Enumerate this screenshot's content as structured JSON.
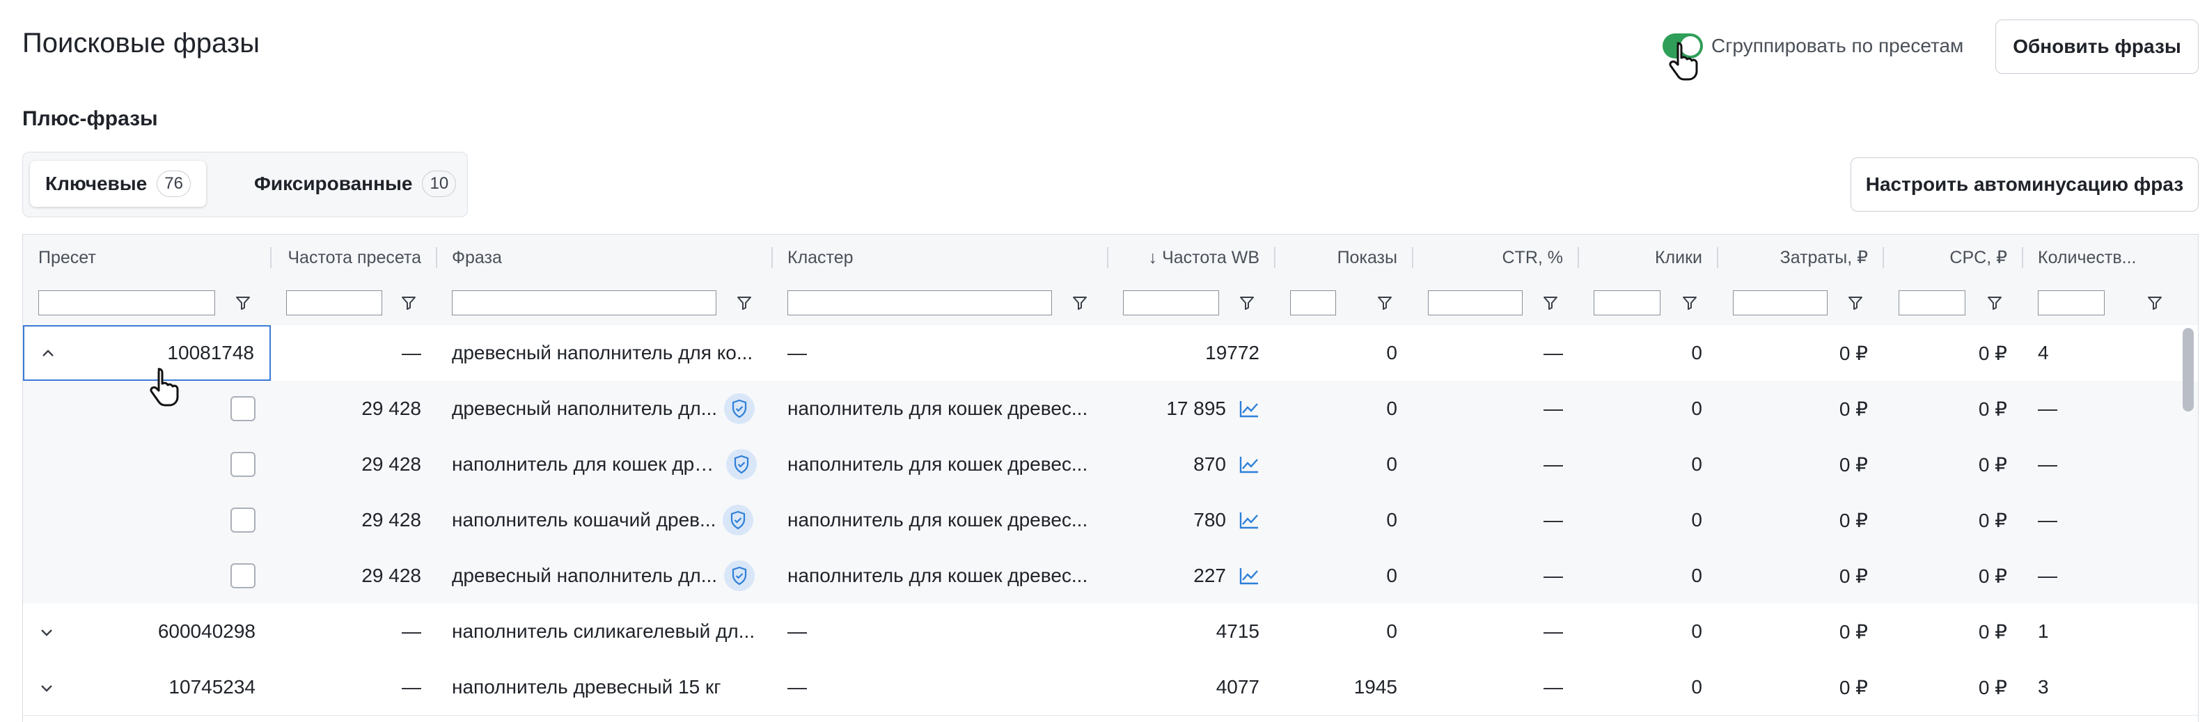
{
  "page": {
    "title": "Поисковые фразы",
    "group_toggle": {
      "label": "Сгруппировать по пресетам",
      "on": true
    },
    "refresh_button": "Обновить фразы",
    "section_title": "Плюс-фразы",
    "tabs": [
      {
        "label": "Ключевые",
        "count": "76",
        "active": true
      },
      {
        "label": "Фиксированные",
        "count": "10",
        "active": false
      }
    ],
    "autominus_button": "Настроить автоминусацию фраз"
  },
  "table": {
    "columns": [
      {
        "key": "preset",
        "label": "Пресет"
      },
      {
        "key": "preset_freq",
        "label": "Частота пресета"
      },
      {
        "key": "phrase",
        "label": "Фраза"
      },
      {
        "key": "cluster",
        "label": "Кластер"
      },
      {
        "key": "wb_freq",
        "label": "↓ Частота WB"
      },
      {
        "key": "views",
        "label": "Показы"
      },
      {
        "key": "ctr",
        "label": "CTR, %"
      },
      {
        "key": "clicks",
        "label": "Клики"
      },
      {
        "key": "cost",
        "label": "Затраты, ₽"
      },
      {
        "key": "cpc",
        "label": "CPC, ₽"
      },
      {
        "key": "count",
        "label": "Количеств..."
      }
    ],
    "rows": [
      {
        "type": "group",
        "expanded": true,
        "preset": "10081748",
        "preset_freq": "—",
        "phrase": "древесный наполнитель для ко...",
        "cluster": "—",
        "wb_freq": "19772",
        "views": "0",
        "ctr": "—",
        "clicks": "0",
        "cost": "0 ₽",
        "cpc": "0 ₽",
        "count": "4"
      },
      {
        "type": "child",
        "preset_freq": "29 428",
        "phrase": "древесный наполнитель дл...",
        "cluster": "наполнитель для кошек древес...",
        "wb_freq": "17 895",
        "views": "0",
        "ctr": "—",
        "clicks": "0",
        "cost": "0 ₽",
        "cpc": "0 ₽",
        "count": "—"
      },
      {
        "type": "child",
        "preset_freq": "29 428",
        "phrase": "наполнитель для кошек дре...",
        "cluster": "наполнитель для кошек древес...",
        "wb_freq": "870",
        "views": "0",
        "ctr": "—",
        "clicks": "0",
        "cost": "0 ₽",
        "cpc": "0 ₽",
        "count": "—"
      },
      {
        "type": "child",
        "preset_freq": "29 428",
        "phrase": "наполнитель кошачий древ...",
        "cluster": "наполнитель для кошек древес...",
        "wb_freq": "780",
        "views": "0",
        "ctr": "—",
        "clicks": "0",
        "cost": "0 ₽",
        "cpc": "0 ₽",
        "count": "—"
      },
      {
        "type": "child",
        "preset_freq": "29 428",
        "phrase": "древесный наполнитель дл...",
        "cluster": "наполнитель для кошек древес...",
        "wb_freq": "227",
        "views": "0",
        "ctr": "—",
        "clicks": "0",
        "cost": "0 ₽",
        "cpc": "0 ₽",
        "count": "—"
      },
      {
        "type": "group",
        "expanded": false,
        "preset": "600040298",
        "preset_freq": "—",
        "phrase": "наполнитель силикагелевый дл...",
        "cluster": "—",
        "wb_freq": "4715",
        "views": "0",
        "ctr": "—",
        "clicks": "0",
        "cost": "0 ₽",
        "cpc": "0 ₽",
        "count": "1"
      },
      {
        "type": "group",
        "expanded": false,
        "preset": "10745234",
        "preset_freq": "—",
        "phrase": "наполнитель древесный 15 кг",
        "cluster": "—",
        "wb_freq": "4077",
        "views": "1945",
        "ctr": "—",
        "clicks": "0",
        "cost": "0 ₽",
        "cpc": "0 ₽",
        "count": "3"
      }
    ]
  },
  "colors": {
    "toggle_on": "#2f9e58",
    "selection_border": "#3b7bd6",
    "shield_bg": "#d8e6f8",
    "shield_icon": "#2f7fd8",
    "trend_icon": "#2f7fd8"
  },
  "icons": {
    "cursor": "hand-pointer-icon",
    "filter": "filter-funnel-icon",
    "expand": "chevron-down-icon",
    "collapse": "chevron-up-icon",
    "fixed": "shield-check-icon",
    "trend": "trend-chart-icon"
  }
}
